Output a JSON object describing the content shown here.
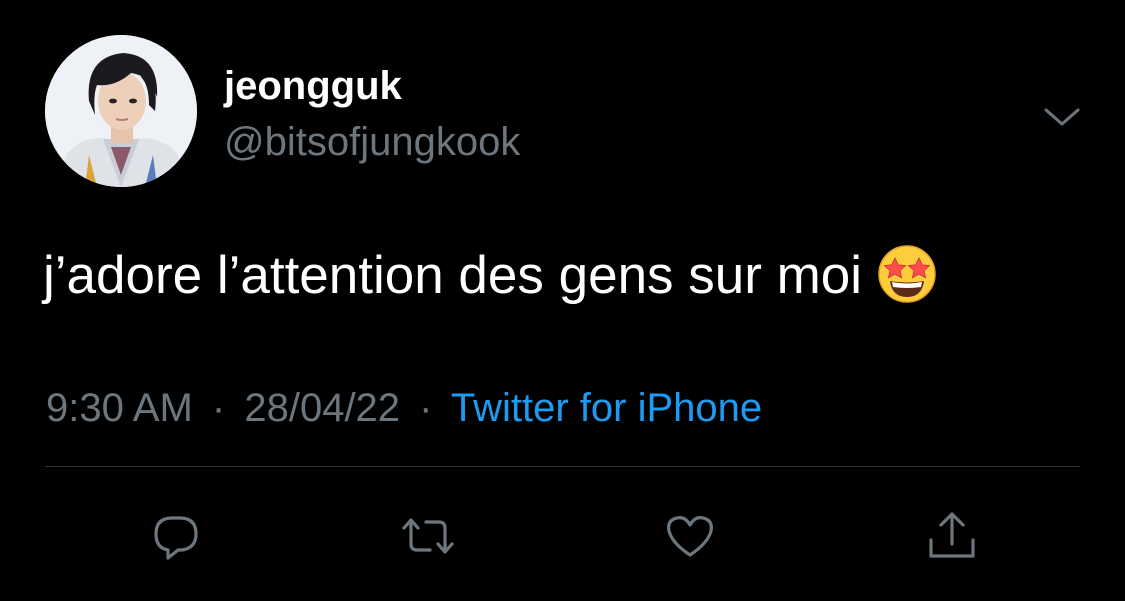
{
  "tweet": {
    "author": {
      "display_name": "jeongguk",
      "handle": "@bitsofjungkook"
    },
    "text": "j’adore l’attention des gens sur moi",
    "emoji": "star-struck",
    "meta": {
      "time": "9:30 AM",
      "separator": "·",
      "date": "28/04/22",
      "source": "Twitter for iPhone"
    }
  },
  "icons": {
    "menu": "chevron-down-icon",
    "reply": "reply-icon",
    "retweet": "retweet-icon",
    "like": "heart-icon",
    "share": "share-icon"
  },
  "colors": {
    "background": "#000000",
    "primary_text": "#ffffff",
    "secondary_text": "#6e767d",
    "link": "#1d9bf0",
    "divider": "#2f3336"
  }
}
